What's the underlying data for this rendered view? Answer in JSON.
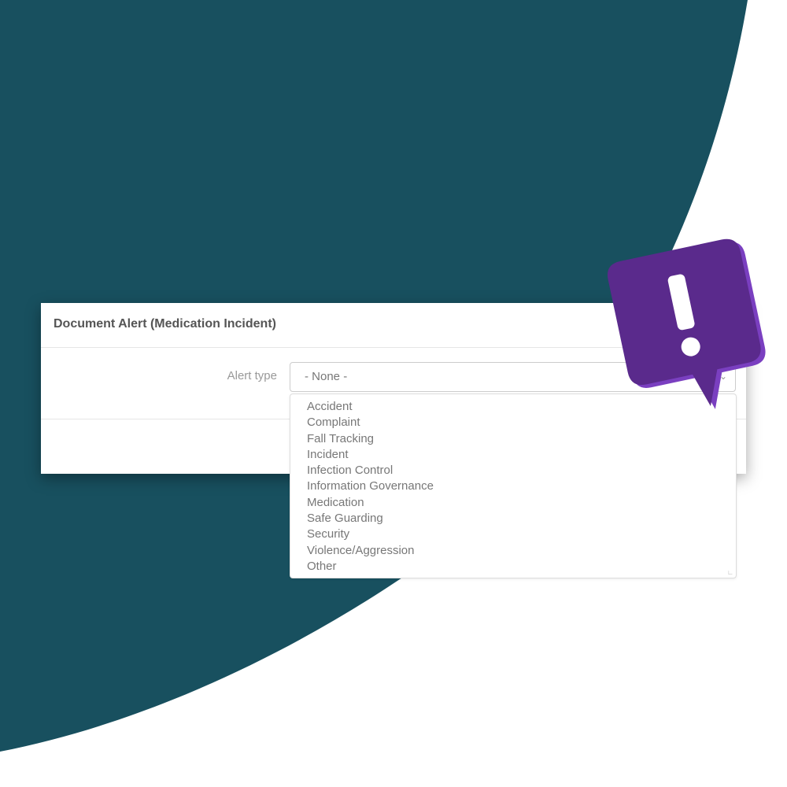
{
  "colors": {
    "background_teal": "#18505f",
    "background_white": "#ffffff",
    "alert_purple": "#5a2a8c",
    "alert_purple_edge": "#7a3fc0"
  },
  "dialog": {
    "title": "Document Alert (Medication Incident)",
    "field_label": "Alert type",
    "select_value": "- None -"
  },
  "dropdown": {
    "options": [
      "Accident",
      "Complaint",
      "Fall Tracking",
      "Incident",
      "Infection Control",
      "Information Governance",
      "Medication",
      "Safe Guarding",
      "Security",
      "Violence/Aggression",
      "Other"
    ]
  },
  "icons": {
    "alert": "exclamation-speech-bubble-icon",
    "chevron": "chevron-down-icon"
  }
}
